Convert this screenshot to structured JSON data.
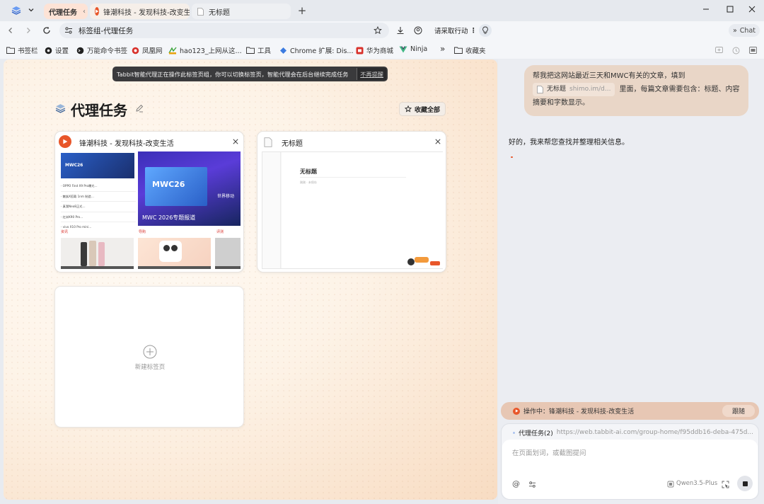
{
  "tabs": {
    "group_label": "代理任务",
    "tab1_title": "锋潮科技 - 发现科技-改变生",
    "tab2_title": "无标题",
    "new_tab": "+"
  },
  "toolbar": {
    "address": "标签组-代理任务",
    "action_chip": "请采取行动",
    "chat_label": "Chat"
  },
  "bookmarks": [
    {
      "label": "书签栏",
      "icon": "folder-icon"
    },
    {
      "label": "设置",
      "icon": "gear-icon"
    },
    {
      "label": "万能命令书签",
      "icon": "command-icon"
    },
    {
      "label": "凤凰网",
      "icon": "phoenix-icon"
    },
    {
      "label": "hao123_上网从这...",
      "icon": "hao123-icon"
    },
    {
      "label": "工具",
      "icon": "folder-icon"
    },
    {
      "label": "Chrome 扩展: Dis...",
      "icon": "extension-icon"
    },
    {
      "label": "华为商城",
      "icon": "huawei-icon"
    },
    {
      "label": "Ninja",
      "icon": "vue-icon"
    },
    {
      "label": "»",
      "icon": ""
    },
    {
      "label": "收藏夹",
      "icon": "folder-icon"
    }
  ],
  "notice": {
    "text": "Tabbit智能代理正在操作此标签页组，你可以切换标签页，智能代理会在后台继续完成任务",
    "dismiss": "不再提醒"
  },
  "group": {
    "title": "代理任务",
    "collect_all": "收藏全部"
  },
  "cards": {
    "card1_title": "锋潮科技 - 发现科技-改变生活",
    "card2_title": "无标题",
    "new_tab_label": "新建标签页"
  },
  "thumb1": {
    "headline_top": "MWC26",
    "hero_title": "MWC26",
    "hero_sub": "世界移动",
    "hero_caption": "MWC 2026专题报道",
    "list": [
      "· OPPO Find X9 Pro曝光…",
      "· 魅族X搭载 1nm 制造…",
      "· 真我Neo8正式…",
      "· 红米K90 Pro…",
      "· vivo X10 Pro mini…"
    ],
    "tabs": [
      "资讯",
      "导购",
      "评测"
    ]
  },
  "thumb2": {
    "doc_title": "无标题",
    "doc_meta": "刚刚 · 未保存"
  },
  "chat": {
    "user_msg_line1": "帮我把这网站最近三天和MWC有关的文章，填到",
    "doc_chip_title": "无标题",
    "doc_chip_url": "shimo.im/d...",
    "user_msg_line2_rest": "里面，每篇文章需要包含：标题、内容",
    "user_msg_line3": "摘要和字数显示。",
    "assistant_msg": "好的，我来帮您查找并整理相关信息。",
    "operating_label": "操作中：锋潮科技 - 发现科技-改变生活",
    "follow_button": "跟随",
    "context_title": "代理任务(2)",
    "context_url": "https://web.tabbit-ai.com/group-home/f95ddb16-deba-475d...",
    "input_placeholder": "在页面划词，或截图提问",
    "model_name": "Qwen3.5-Plus"
  },
  "colors": {
    "accent_orange": "#e8562a",
    "chat_bubble": "#e9d6c7",
    "operating_bar": "#e7c7b4",
    "notice_bg": "#3a3a3c"
  }
}
